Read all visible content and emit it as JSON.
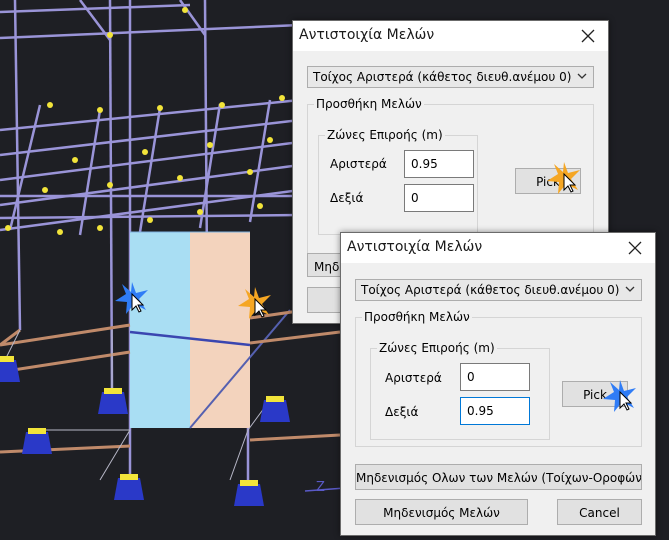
{
  "scene": {
    "axis_label": "Z"
  },
  "dialog_back": {
    "title": "Αντιστοιχία Μελών",
    "combo_value": "Τοίχος Αριστερά (κάθετος διευθ.ανέμου 0)",
    "group_title": "Προσθήκη Μελών",
    "zones_title": "Ζώνες Επιροής (m)",
    "left_label": "Αριστερά",
    "left_value": "0.95",
    "right_label": "Δεξιά",
    "right_value": "0",
    "pick_label": "Pick",
    "reset_all_partial": "Μηδε"
  },
  "dialog_front": {
    "title": "Αντιστοιχία Μελών",
    "combo_value": "Τοίχος Αριστερά (κάθετος διευθ.ανέμου 0)",
    "group_title": "Προσθήκη Μελών",
    "zones_title": "Ζώνες Επιροής (m)",
    "left_label": "Αριστερά",
    "left_value": "0",
    "right_label": "Δεξιά",
    "right_value": "0.95",
    "pick_label": "Pick",
    "reset_all_label": "Μηδενισμός Ολων των Μελών (Τοίχων-Οροφών)",
    "reset_label": "Μηδενισμός Μελών",
    "cancel_label": "Cancel"
  },
  "colors": {
    "viewport_bg": "#1e1f24",
    "frame_lines": "#9a94d8",
    "beam_lines": "#c08a6a",
    "node_yellow": "#f2e43a",
    "support_blue": "#2a39c8",
    "wall_left_fill": "#a9def3",
    "wall_right_fill": "#f3d3bd",
    "cursor_blue": "#2f7cf6",
    "cursor_orange": "#f5a623",
    "focus_blue": "#0078d7"
  }
}
